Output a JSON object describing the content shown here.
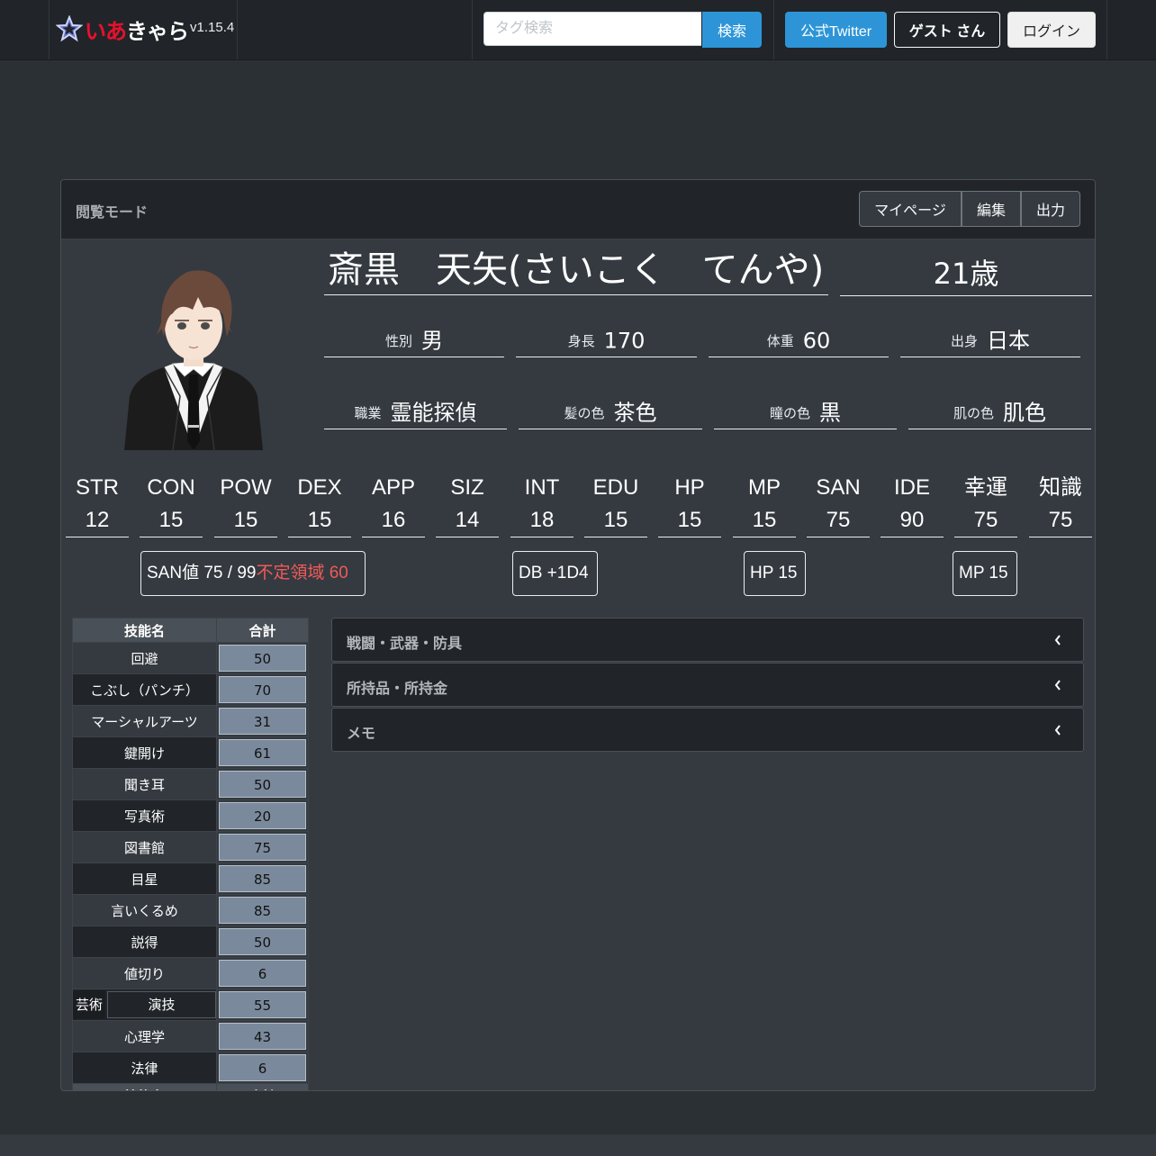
{
  "app": {
    "logo_text_red": "いあ",
    "logo_text_white": "きゃら",
    "version": "v1.15.4"
  },
  "nav": {
    "search_placeholder": "タグ検索",
    "search_button": "検索",
    "twitter_button": "公式Twitter",
    "guest_button": "ゲスト さん",
    "login_button": "ログイン"
  },
  "header": {
    "mode": "閲覧モード",
    "buttons": [
      "マイページ",
      "編集",
      "出力"
    ]
  },
  "character": {
    "name": "斎黒　天矢(さいこく　てんや)",
    "age": "21歳",
    "props_row1": [
      {
        "label": "性別",
        "value": "男"
      },
      {
        "label": "身長",
        "value": "170"
      },
      {
        "label": "体重",
        "value": "60"
      },
      {
        "label": "出身",
        "value": "日本"
      }
    ],
    "props_row2": [
      {
        "label": "職業",
        "value": "霊能探偵"
      },
      {
        "label": "髪の色",
        "value": "茶色"
      },
      {
        "label": "瞳の色",
        "value": "黒"
      },
      {
        "label": "肌の色",
        "value": "肌色"
      }
    ]
  },
  "stats": [
    {
      "name": "STR",
      "value": "12"
    },
    {
      "name": "CON",
      "value": "15"
    },
    {
      "name": "POW",
      "value": "15"
    },
    {
      "name": "DEX",
      "value": "15"
    },
    {
      "name": "APP",
      "value": "16"
    },
    {
      "name": "SIZ",
      "value": "14"
    },
    {
      "name": "INT",
      "value": "18"
    },
    {
      "name": "EDU",
      "value": "15"
    },
    {
      "name": "HP",
      "value": "15"
    },
    {
      "name": "MP",
      "value": "15"
    },
    {
      "name": "SAN",
      "value": "75"
    },
    {
      "name": "IDE",
      "value": "90"
    },
    {
      "name": "幸運",
      "value": "75"
    },
    {
      "name": "知識",
      "value": "75"
    }
  ],
  "badges": {
    "san": "SAN値 75 / 99",
    "san_warning": "不定領域 60",
    "db": "DB +1D4",
    "hp": "HP 15",
    "mp": "MP 15"
  },
  "skill_table": {
    "headers": [
      "技能名",
      "合計"
    ],
    "rows": [
      {
        "name": "回避",
        "value": "50"
      },
      {
        "name": "こぶし（パンチ）",
        "value": "70"
      },
      {
        "name": "マーシャルアーツ",
        "value": "31"
      },
      {
        "name": "鍵開け",
        "value": "61"
      },
      {
        "name": "聞き耳",
        "value": "50"
      },
      {
        "name": "写真術",
        "value": "20"
      },
      {
        "name": "図書館",
        "value": "75"
      },
      {
        "name": "目星",
        "value": "85"
      },
      {
        "name": "言いくるめ",
        "value": "85"
      },
      {
        "name": "説得",
        "value": "50"
      },
      {
        "name": "値切り",
        "value": "6"
      },
      {
        "name": "演技",
        "category": "芸術",
        "value": "55"
      },
      {
        "name": "心理学",
        "value": "43"
      },
      {
        "name": "法律",
        "value": "6"
      }
    ]
  },
  "accordion": [
    {
      "label": "戦闘・武器・防具"
    },
    {
      "label": "所持品・所持金"
    },
    {
      "label": "メモ"
    }
  ]
}
